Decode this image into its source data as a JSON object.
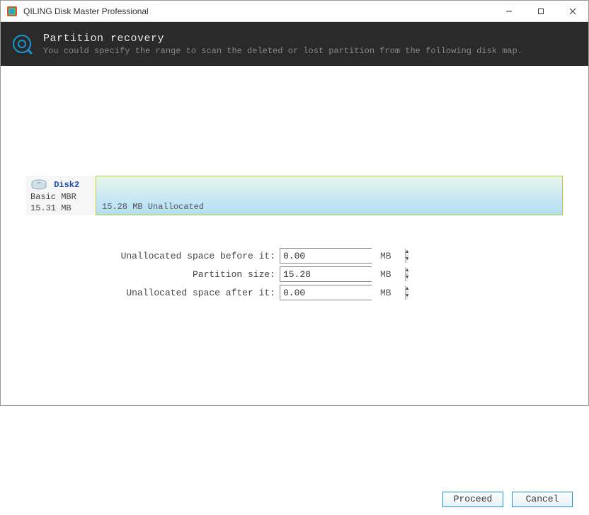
{
  "window": {
    "title": "QILING Disk Master Professional"
  },
  "header": {
    "title": "Partition recovery",
    "subtitle": "You could specify the range to scan the deleted or lost partition from the following disk map."
  },
  "disk": {
    "name": "Disk2",
    "type": "Basic MBR",
    "size": "15.31 MB",
    "partition_label": "15.28 MB Unallocated"
  },
  "form": {
    "before_label": "Unallocated space before it:",
    "before_value": "0.00",
    "before_unit": "MB",
    "size_label": "Partition size:",
    "size_value": "15.28",
    "size_unit": "MB",
    "after_label": "Unallocated space after it:",
    "after_value": "0.00",
    "after_unit": "MB"
  },
  "footer": {
    "proceed": "Proceed",
    "cancel": "Cancel"
  }
}
